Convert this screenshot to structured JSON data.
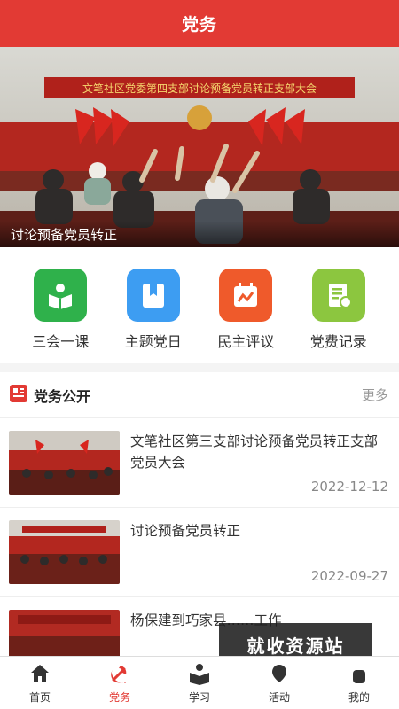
{
  "header": {
    "title": "党务"
  },
  "banner": {
    "caption": "讨论预备党员转正",
    "backdrop_text": "文笔社区党委第四支部讨论预备党员转正支部大会"
  },
  "quick_nav": [
    {
      "label": "三会一课",
      "icon": "book-reader-icon",
      "color": "#2fb14b"
    },
    {
      "label": "主题党日",
      "icon": "bookmark-icon",
      "color": "#3d9df2"
    },
    {
      "label": "民主评议",
      "icon": "chart-calendar-icon",
      "color": "#ef5a2b"
    },
    {
      "label": "党费记录",
      "icon": "receipt-icon",
      "color": "#8cc63f"
    }
  ],
  "section": {
    "title": "党务公开",
    "more": "更多"
  },
  "news": [
    {
      "title": "文笔社区第三支部讨论预备党员转正支部党员大会",
      "date": "2022-12-12"
    },
    {
      "title": "讨论预备党员转正",
      "date": "2022-09-27"
    },
    {
      "title": "杨保建到巧家县……工作",
      "date": ""
    }
  ],
  "watermark": "就收资源站",
  "tabs": [
    {
      "label": "首页",
      "icon": "home-icon"
    },
    {
      "label": "党务",
      "icon": "party-emblem-icon"
    },
    {
      "label": "学习",
      "icon": "study-icon"
    },
    {
      "label": "活动",
      "icon": "activity-icon"
    },
    {
      "label": "我的",
      "icon": "profile-icon"
    }
  ],
  "colors": {
    "brand": "#e23a34",
    "tab_active": "#e23a34"
  }
}
